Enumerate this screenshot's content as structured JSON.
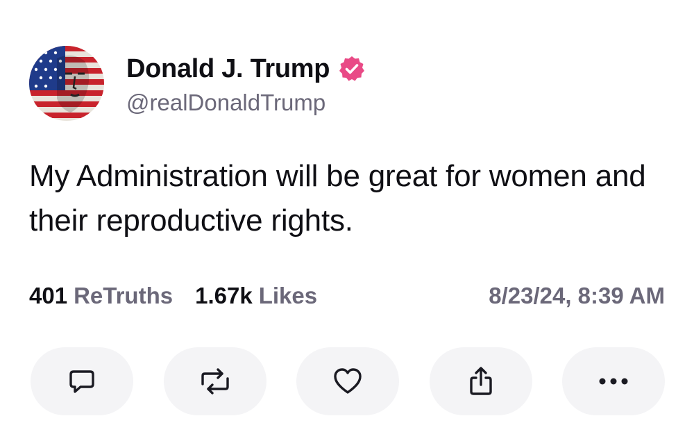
{
  "post": {
    "author": {
      "display_name": "Donald J. Trump",
      "handle": "@realDonaldTrump",
      "verified": true,
      "verified_badge_color": "#e94a86"
    },
    "text": "My Administration will be great for women and their reproductive rights.",
    "stats": {
      "retruths_count": "401",
      "retruths_label": "ReTruths",
      "likes_count": "1.67k",
      "likes_label": "Likes"
    },
    "timestamp": "8/23/24, 8:39 AM"
  },
  "actions": [
    {
      "icon": "reply-icon"
    },
    {
      "icon": "retruth-icon"
    },
    {
      "icon": "heart-icon"
    },
    {
      "icon": "share-icon"
    },
    {
      "icon": "more-icon"
    }
  ],
  "theme": {
    "text_primary": "#0f0f14",
    "text_secondary": "#6b6879",
    "action_background": "#f4f4f6"
  }
}
